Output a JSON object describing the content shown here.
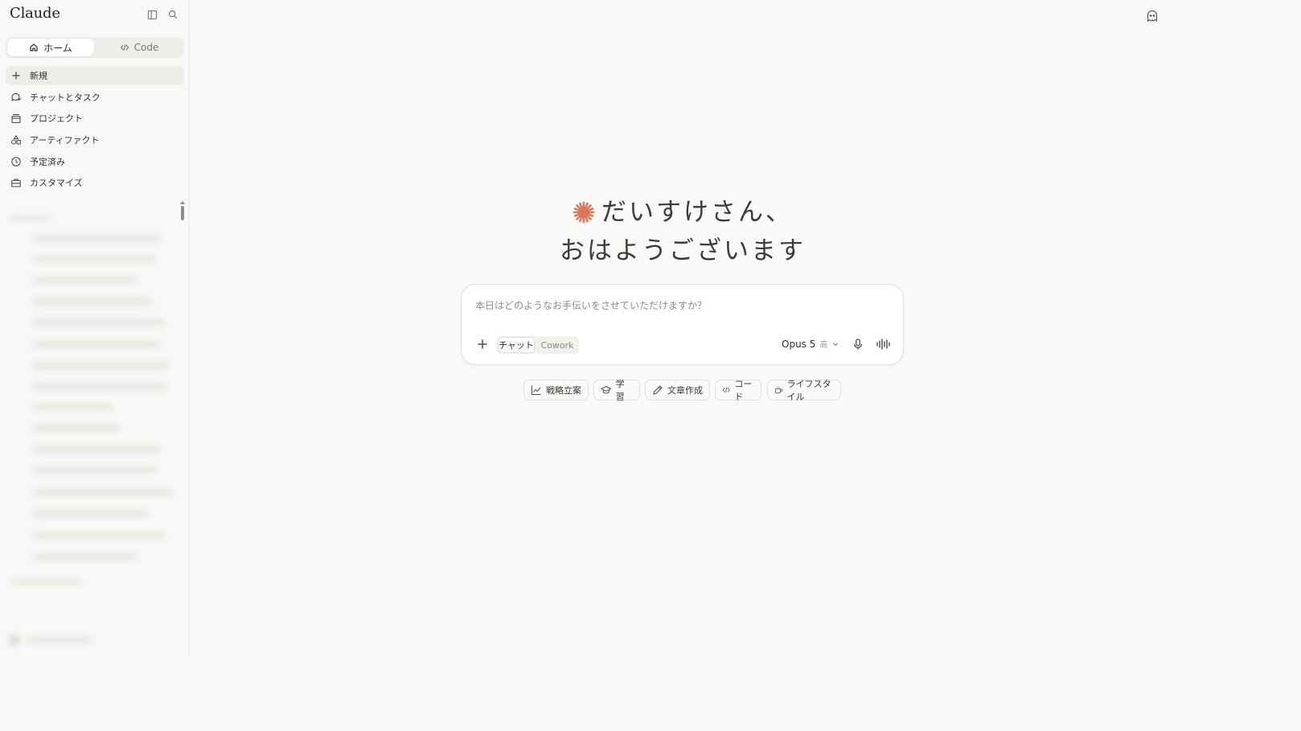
{
  "sidebar": {
    "brand": "Claude",
    "seg": {
      "home_label": "ホーム",
      "code_label": "Code"
    },
    "items": [
      {
        "label": "新規",
        "icon": "plus-icon"
      },
      {
        "label": "チャットとタスク",
        "icon": "chat-icon"
      },
      {
        "label": "プロジェクト",
        "icon": "folder-icon"
      },
      {
        "label": "アーティファクト",
        "icon": "artifacts-icon"
      },
      {
        "label": "予定済み",
        "icon": "clock-icon"
      },
      {
        "label": "カスタマイズ",
        "icon": "briefcase-icon"
      }
    ]
  },
  "main": {
    "greeting_line1": "だいすけさん、",
    "greeting_line2": "おはようございます",
    "composer": {
      "placeholder": "本日はどのようなお手伝いをさせていただけますか？",
      "mode_chat": "チャット",
      "mode_cowork": "Cowork",
      "model": "Opus 5",
      "model_sub": "高"
    },
    "chips": [
      {
        "label": "戦略立案",
        "icon": "chart-icon"
      },
      {
        "label": "学習",
        "icon": "graduation-cap-icon"
      },
      {
        "label": "文章作成",
        "icon": "pencil-icon"
      },
      {
        "label": "コード",
        "icon": "code-icon"
      },
      {
        "label": "ライフスタイル",
        "icon": "coffee-icon"
      }
    ]
  },
  "colors": {
    "accent": "#d97757",
    "background": "#fafaf8",
    "sidebar": "#f8f8f6"
  }
}
